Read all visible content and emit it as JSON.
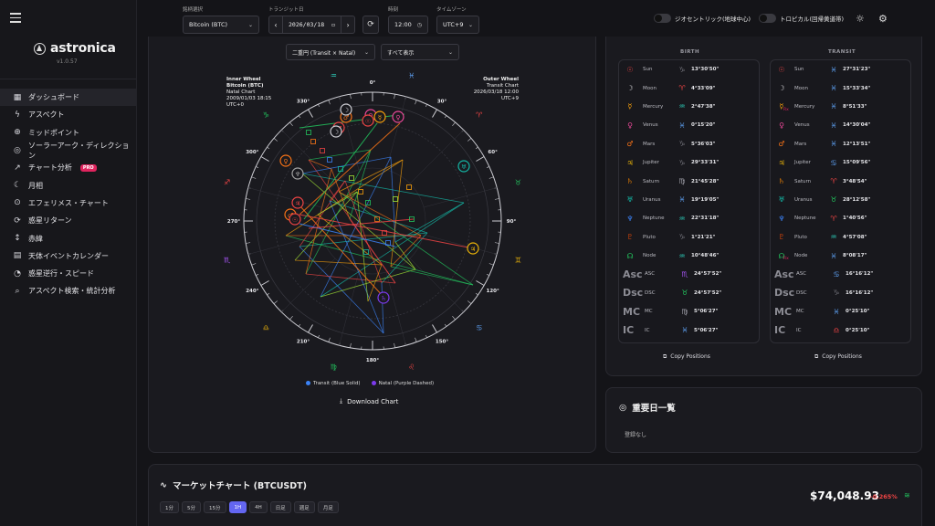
{
  "app": {
    "name": "astronica",
    "version": "v1.0.57"
  },
  "nav": [
    {
      "label": "ダッシュボード",
      "icon": "▦",
      "active": true
    },
    {
      "label": "アスペクト",
      "icon": "ϟ"
    },
    {
      "label": "ミッドポイント",
      "icon": "⊕"
    },
    {
      "label": "ソーラーアーク・ディレクション",
      "icon": "◎"
    },
    {
      "label": "チャート分析",
      "icon": "↗",
      "badge": "PRO"
    },
    {
      "label": "月相",
      "icon": "☾"
    },
    {
      "label": "エフェリメス・チャート",
      "icon": "⊙"
    },
    {
      "label": "惑星リターン",
      "icon": "⟳"
    },
    {
      "label": "赤緯",
      "icon": "↕"
    },
    {
      "label": "天体イベントカレンダー",
      "icon": "▤"
    },
    {
      "label": "惑星逆行・スピード",
      "icon": "◔"
    },
    {
      "label": "アスペクト検索・統計分析",
      "icon": "⌕"
    }
  ],
  "topbar": {
    "symbol_label": "銘柄選択",
    "symbol_value": "Bitcoin (BTC)",
    "transit_label": "トランジット日",
    "transit_value": "2026/03/18",
    "time_label": "時刻",
    "time_value": "12:00",
    "tz_label": "タイムゾーン",
    "tz_value": "UTC+9",
    "geo_toggle": "ジオセントリック(地球中心)",
    "tropical_toggle": "トロピカル(回帰黄道帯)"
  },
  "chart_controls": {
    "wheel_mode": "二重円 (Transit × Natal)",
    "filter": "すべて表示"
  },
  "wheel": {
    "inner": {
      "title": "Inner Wheel",
      "name": "Bitcoin (BTC)",
      "type": "Natal Chart",
      "datetime": "2009/01/03 18:15",
      "tz": "UTC+0"
    },
    "outer": {
      "title": "Outer Wheel",
      "name": "Transit Chart",
      "type": "Transit Chart",
      "datetime": "2026/03/18 12:00",
      "tz": "UTC+9"
    },
    "degree_labels": [
      "0°",
      "30°",
      "60°",
      "90°",
      "120°",
      "150°",
      "180°",
      "210°",
      "240°",
      "270°",
      "300°",
      "330°"
    ],
    "sign_glyphs": [
      "♓",
      "♈",
      "♉",
      "♊",
      "♋",
      "♌",
      "♍",
      "♎",
      "♏",
      "♐",
      "♑",
      "♒"
    ],
    "legend_transit": "Transit (Blue Solid)",
    "legend_natal": "Natal (Purple Dashed)",
    "download_label": "Download Chart"
  },
  "positions": {
    "birth_header": "BIRTH",
    "transit_header": "TRANSIT",
    "birth": [
      {
        "glyph": "☉",
        "name": "Sun",
        "sign": "♑",
        "deg": "13°30'50\"",
        "color": "#ef4444",
        "sign_color": "#6b6b72"
      },
      {
        "glyph": "☽",
        "name": "Moon",
        "sign": "♈",
        "deg": "4°33'09\"",
        "color": "#d4d4d8",
        "sign_color": "#ef4444"
      },
      {
        "glyph": "☿",
        "name": "Mercury",
        "sign": "♒",
        "deg": "2°47'38\"",
        "color": "#f59e0b",
        "sign_color": "#2dd4bf"
      },
      {
        "glyph": "♀",
        "name": "Venus",
        "sign": "♓",
        "deg": "0°15'20\"",
        "color": "#ec4899",
        "sign_color": "#60a5fa"
      },
      {
        "glyph": "♂",
        "name": "Mars",
        "sign": "♑",
        "deg": "5°36'03\"",
        "color": "#f97316",
        "sign_color": "#6b6b72"
      },
      {
        "glyph": "♃",
        "name": "Jupiter",
        "sign": "♑",
        "deg": "29°33'31\"",
        "color": "#eab308",
        "sign_color": "#6b6b72"
      },
      {
        "glyph": "♄",
        "name": "Saturn",
        "sign": "♍",
        "deg": "21°45'28\"",
        "color": "#d97706",
        "sign_color": "#a1a1aa"
      },
      {
        "glyph": "♅",
        "name": "Uranus",
        "sign": "♓",
        "deg": "19°19'05\"",
        "color": "#14b8a6",
        "sign_color": "#60a5fa"
      },
      {
        "glyph": "♆",
        "name": "Neptune",
        "sign": "♒",
        "deg": "22°31'18\"",
        "color": "#3b82f6",
        "sign_color": "#2dd4bf"
      },
      {
        "glyph": "♇",
        "name": "Pluto",
        "sign": "♑",
        "deg": "1°21'21\"",
        "color": "#c2410c",
        "sign_color": "#6b6b72"
      },
      {
        "glyph": "☊",
        "name": "Node",
        "sign": "♒",
        "deg": "10°48'46\"",
        "color": "#22c55e",
        "sign_color": "#2dd4bf"
      },
      {
        "glyph": "Asc",
        "name": "ASC",
        "sign": "♏",
        "deg": "24°57'52\"",
        "big": true,
        "sign_color": "#a855f7"
      },
      {
        "glyph": "Dsc",
        "name": "DSC",
        "sign": "♉",
        "deg": "24°57'52\"",
        "big": true,
        "sign_color": "#22c55e"
      },
      {
        "glyph": "MC",
        "name": "MC",
        "sign": "♍",
        "deg": "5°06'27\"",
        "big": true,
        "sign_color": "#a1a1aa"
      },
      {
        "glyph": "IC",
        "name": "IC",
        "sign": "♓",
        "deg": "5°06'27\"",
        "big": true,
        "sign_color": "#60a5fa"
      }
    ],
    "transit": [
      {
        "glyph": "☉",
        "name": "Sun",
        "sign": "♓",
        "deg": "27°31'23\"",
        "color": "#ef4444",
        "sign_color": "#60a5fa"
      },
      {
        "glyph": "☽",
        "name": "Moon",
        "sign": "♓",
        "deg": "15°33'34\"",
        "color": "#d4d4d8",
        "sign_color": "#60a5fa"
      },
      {
        "glyph": "☿",
        "name": "Mercury",
        "sign": "♓",
        "deg": "8°51'33\"",
        "color": "#f59e0b",
        "sign_color": "#60a5fa",
        "rx": true
      },
      {
        "glyph": "♀",
        "name": "Venus",
        "sign": "♓",
        "deg": "14°30'04\"",
        "color": "#ec4899",
        "sign_color": "#60a5fa"
      },
      {
        "glyph": "♂",
        "name": "Mars",
        "sign": "♓",
        "deg": "12°13'51\"",
        "color": "#f97316",
        "sign_color": "#60a5fa"
      },
      {
        "glyph": "♃",
        "name": "Jupiter",
        "sign": "♋",
        "deg": "15°09'56\"",
        "color": "#eab308",
        "sign_color": "#60a5fa"
      },
      {
        "glyph": "♄",
        "name": "Saturn",
        "sign": "♈",
        "deg": "3°48'54\"",
        "color": "#d97706",
        "sign_color": "#ef4444"
      },
      {
        "glyph": "♅",
        "name": "Uranus",
        "sign": "♉",
        "deg": "28°12'58\"",
        "color": "#14b8a6",
        "sign_color": "#22c55e"
      },
      {
        "glyph": "♆",
        "name": "Neptune",
        "sign": "♈",
        "deg": "1°40'56\"",
        "color": "#3b82f6",
        "sign_color": "#ef4444"
      },
      {
        "glyph": "♇",
        "name": "Pluto",
        "sign": "♒",
        "deg": "4°57'08\"",
        "color": "#c2410c",
        "sign_color": "#2dd4bf"
      },
      {
        "glyph": "☊",
        "name": "Node",
        "sign": "♓",
        "deg": "8°08'17\"",
        "color": "#22c55e",
        "sign_color": "#60a5fa",
        "rx": true
      },
      {
        "glyph": "Asc",
        "name": "ASC",
        "sign": "♋",
        "deg": "16°16'12\"",
        "big": true,
        "sign_color": "#60a5fa"
      },
      {
        "glyph": "Dsc",
        "name": "DSC",
        "sign": "♑",
        "deg": "16°16'12\"",
        "big": true,
        "sign_color": "#6b6b72"
      },
      {
        "glyph": "MC",
        "name": "MC",
        "sign": "♓",
        "deg": "0°25'10\"",
        "big": true,
        "sign_color": "#60a5fa"
      },
      {
        "glyph": "IC",
        "name": "IC",
        "sign": "♎",
        "deg": "0°25'10\"",
        "big": true,
        "sign_color": "#ef4444"
      }
    ],
    "copy_label": "Copy Positions"
  },
  "important_dates": {
    "title": "重要日一覧",
    "empty": "登録なし"
  },
  "market": {
    "title": "マーケットチャート (BTCUSDT)",
    "price": "$74,048.93",
    "change": "-0.265%",
    "timeframes": [
      "1分",
      "5分",
      "15分",
      "1H",
      "4H",
      "日足",
      "週足",
      "月足"
    ],
    "active_tf": "1H"
  },
  "colors": {
    "accent": "#6366f1",
    "negative": "#ef4444",
    "positive": "#22c55e"
  }
}
